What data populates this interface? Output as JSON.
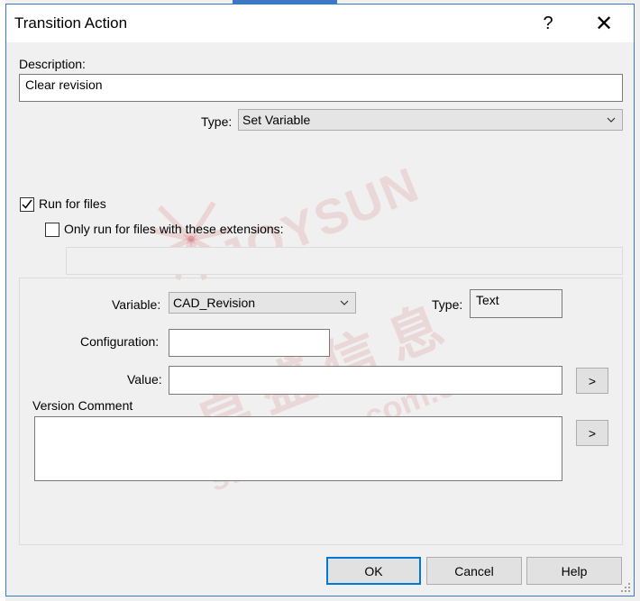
{
  "window": {
    "title": "Transition Action",
    "help_symbol": "?",
    "close_symbol": "✕"
  },
  "description": {
    "label": "Description:",
    "value": "Clear revision"
  },
  "type_field": {
    "label": "Type:",
    "value": "Set Variable"
  },
  "run_for_files": {
    "label": "Run for files",
    "checked": true
  },
  "only_extensions": {
    "label": "Only run for files with these extensions:",
    "checked": false
  },
  "variable": {
    "label": "Variable:",
    "value": "CAD_Revision"
  },
  "variable_type": {
    "label": "Type:",
    "value": "Text"
  },
  "configuration": {
    "label": "Configuration:",
    "value": ""
  },
  "value_field": {
    "label": "Value:",
    "value": "",
    "picker_label": ">"
  },
  "version_comment": {
    "label": "Version Comment",
    "value": "",
    "picker_label": ">"
  },
  "buttons": {
    "ok": "OK",
    "cancel": "Cancel",
    "help": "Help"
  },
  "watermark": {
    "brand": "JOYSUN",
    "chinese": "卓 盛 信 息",
    "url": "sw-joysun.com.cn"
  },
  "colors": {
    "window_border": "#3a78c8",
    "default_button_border": "#0078d7",
    "watermark": "#c82828"
  }
}
